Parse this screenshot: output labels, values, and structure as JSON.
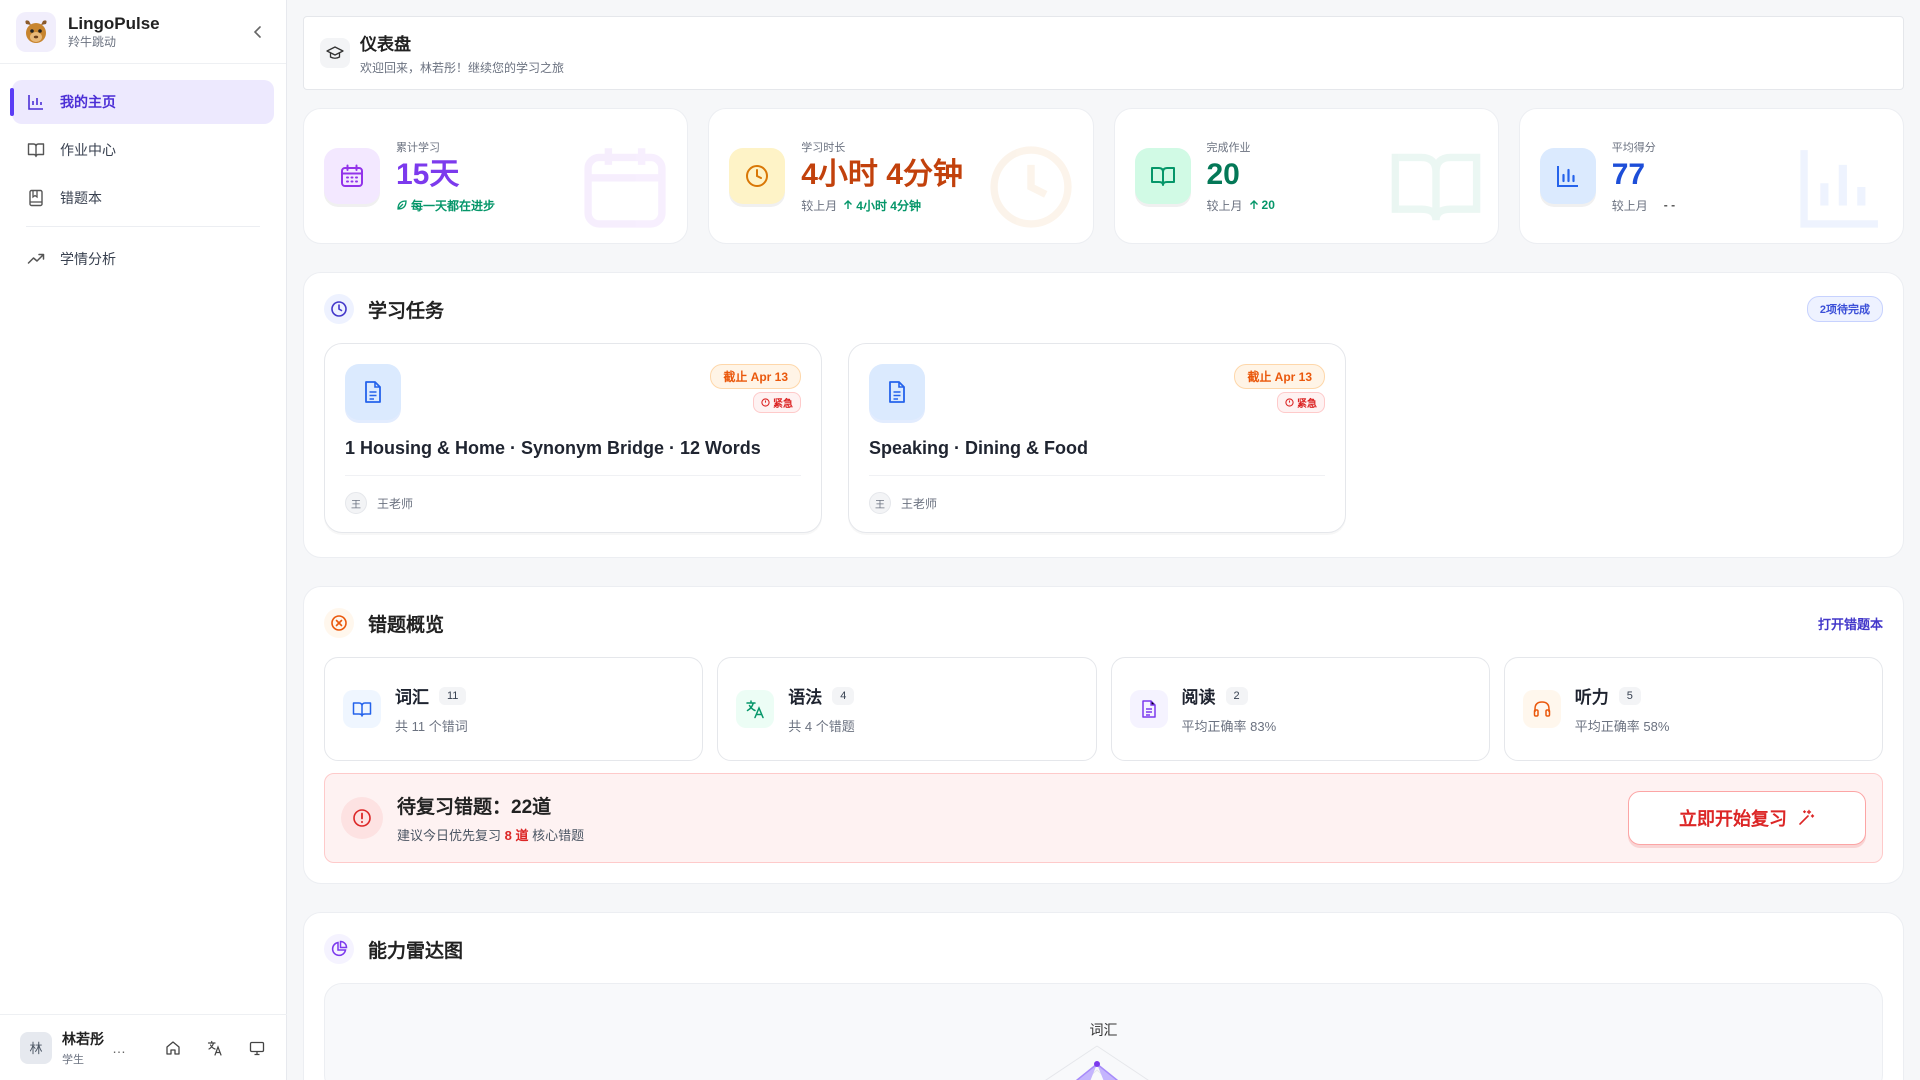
{
  "brand": {
    "name": "LingoPulse",
    "sub": "羚牛跳动"
  },
  "nav": [
    {
      "label": "我的主页",
      "icon": "bar-chart-icon",
      "active": true
    },
    {
      "label": "作业中心",
      "icon": "open-book-icon"
    },
    {
      "label": "错题本",
      "icon": "notebook-icon"
    },
    {
      "label": "学情分析",
      "icon": "trending-up-icon"
    }
  ],
  "user": {
    "avatar": "林",
    "name": "林若彤",
    "role": "学生",
    "more": "…"
  },
  "header": {
    "title": "仪表盘",
    "subtitle": "欢迎回来，林若彤！继续您的学习之旅"
  },
  "stats": [
    {
      "label": "累计学习",
      "value": "15天",
      "foot": "每一天都在进步",
      "color": "#7c3aed"
    },
    {
      "label": "学习时长",
      "value": "4小时 4分钟",
      "foot_prefix": "较上月",
      "foot_up": "4小时 4分钟",
      "color": "#c2410c"
    },
    {
      "label": "完成作业",
      "value": "20",
      "foot_prefix": "较上月",
      "foot_up": "20",
      "color": "#047857"
    },
    {
      "label": "平均得分",
      "value": "77",
      "foot_prefix": "较上月",
      "foot_flat": "- -",
      "color": "#1d4ed8"
    }
  ],
  "tasks_section": {
    "title": "学习任务",
    "badge": "2项待完成",
    "tasks": [
      {
        "title": "1 Housing & Home · Synonym Bridge · 12 Words",
        "due": "截止 Apr 13",
        "urgent": "紧急",
        "teacher_avatar": "王",
        "teacher": "王老师"
      },
      {
        "title": "Speaking · Dining & Food",
        "due": "截止 Apr 13",
        "urgent": "紧急",
        "teacher_avatar": "王",
        "teacher": "王老师"
      }
    ]
  },
  "mistakes_section": {
    "title": "错题概览",
    "link": "打开错题本",
    "categories": [
      {
        "name": "词汇",
        "count": "11",
        "desc": "共 11 个错词",
        "icon": "open-book-icon",
        "color": "#2563eb",
        "bg": "#eff6ff"
      },
      {
        "name": "语法",
        "count": "4",
        "desc": "共 4 个错题",
        "icon": "translate-icon",
        "color": "#059669",
        "bg": "#ecfdf5"
      },
      {
        "name": "阅读",
        "count": "2",
        "desc": "平均正确率 83%",
        "icon": "document-icon",
        "color": "#7c3aed",
        "bg": "#f5f3ff"
      },
      {
        "name": "听力",
        "count": "5",
        "desc": "平均正确率 58%",
        "icon": "headphones-icon",
        "color": "#ea580c",
        "bg": "#fff7ed"
      }
    ],
    "review": {
      "title": "待复习错题：22道",
      "sub_prefix": "建议今日优先复习 ",
      "sub_highlight": "8 道",
      "sub_suffix": " 核心错题",
      "button": "立即开始复习"
    }
  },
  "radar_section": {
    "title": "能力雷达图",
    "top_label": "词汇"
  }
}
